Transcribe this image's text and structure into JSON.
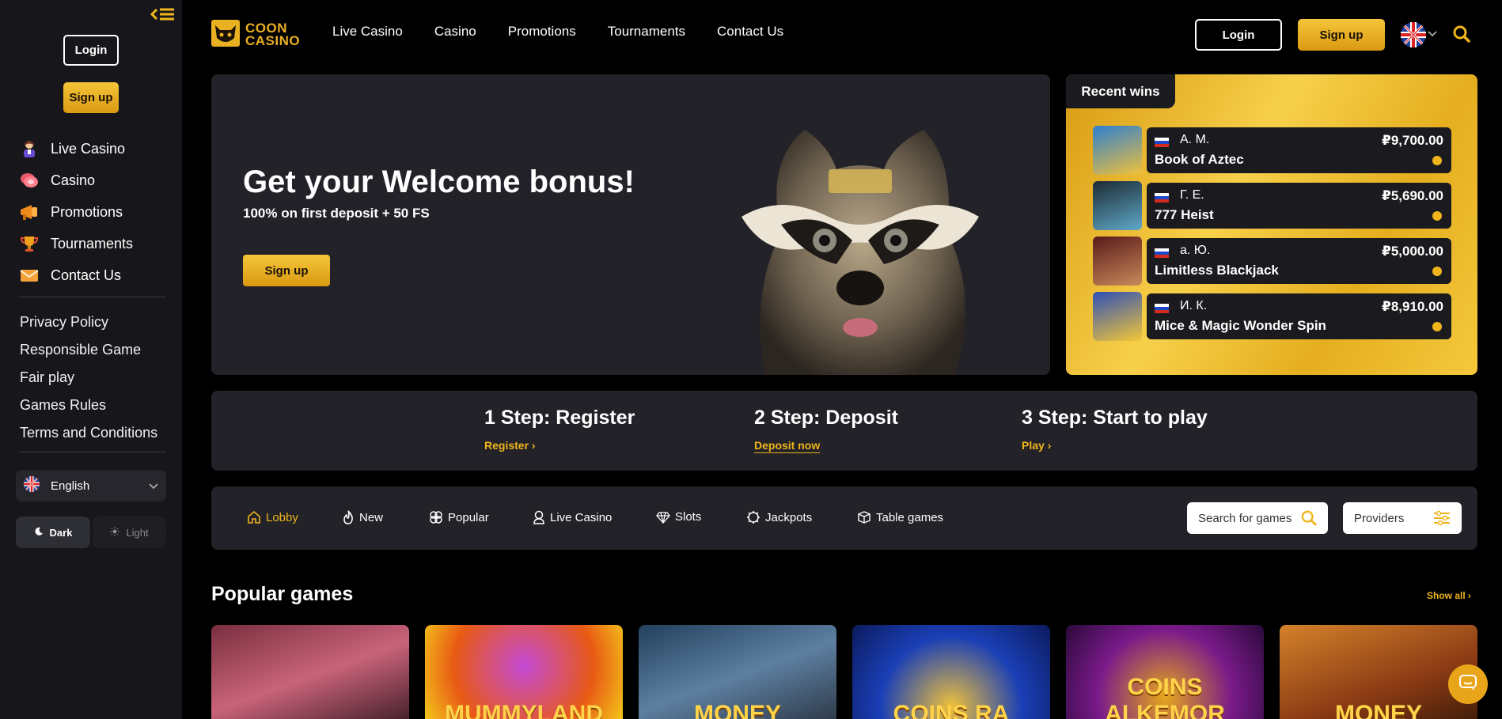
{
  "sidebar": {
    "login_label": "Login",
    "signup_label": "Sign up",
    "nav": [
      {
        "label": "Live Casino",
        "icon": "dealer-icon"
      },
      {
        "label": "Casino",
        "icon": "chips-icon"
      },
      {
        "label": "Promotions",
        "icon": "megaphone-icon"
      },
      {
        "label": "Tournaments",
        "icon": "trophy-icon"
      },
      {
        "label": "Contact Us",
        "icon": "envelope-icon"
      }
    ],
    "links": [
      "Privacy Policy",
      "Responsible Game",
      "Fair play",
      "Games Rules",
      "Terms and Conditions"
    ],
    "language": "English",
    "theme_dark": "Dark",
    "theme_light": "Light"
  },
  "header": {
    "logo_line1": "COON",
    "logo_line2": "CASINO",
    "nav": [
      "Live Casino",
      "Casino",
      "Promotions",
      "Tournaments",
      "Contact Us"
    ],
    "login_label": "Login",
    "signup_label": "Sign up"
  },
  "hero": {
    "title": "Get your Welcome bonus!",
    "subtitle": "100% on first deposit + 50 FS",
    "button": "Sign up"
  },
  "recent_wins": {
    "title": "Recent wins",
    "items": [
      {
        "user": "А. М.",
        "game": "Book of Aztec",
        "amount": "₽9,700.00"
      },
      {
        "user": "Г. Е.",
        "game": "777 Heist",
        "amount": "₽5,690.00"
      },
      {
        "user": "а. Ю.",
        "game": "Limitless Blackjack",
        "amount": "₽5,000.00"
      },
      {
        "user": "И. К.",
        "game": "Mice & Magic Wonder Spin",
        "amount": "₽8,910.00"
      }
    ]
  },
  "steps": [
    {
      "title": "1 Step: Register",
      "link": "Register"
    },
    {
      "title": "2 Step: Deposit",
      "link": "Deposit now"
    },
    {
      "title": "3 Step: Start to play",
      "link": "Play"
    }
  ],
  "categories": [
    "Lobby",
    "New",
    "Popular",
    "Live Casino",
    "Slots",
    "Jackpots",
    "Table games"
  ],
  "search": {
    "placeholder": "Search for games"
  },
  "providers_label": "Providers",
  "popular": {
    "title": "Popular games",
    "show_all": "Show all",
    "games": [
      {
        "title": ""
      },
      {
        "title": "MUMMYLAND"
      },
      {
        "title": "MONEY"
      },
      {
        "title": "COINS RA"
      },
      {
        "title": "COINS ALKEMOR"
      },
      {
        "title": "MONEY"
      }
    ]
  },
  "colors": {
    "accent": "#f0b51d",
    "panel": "#222228",
    "sidebar": "#17171b"
  }
}
